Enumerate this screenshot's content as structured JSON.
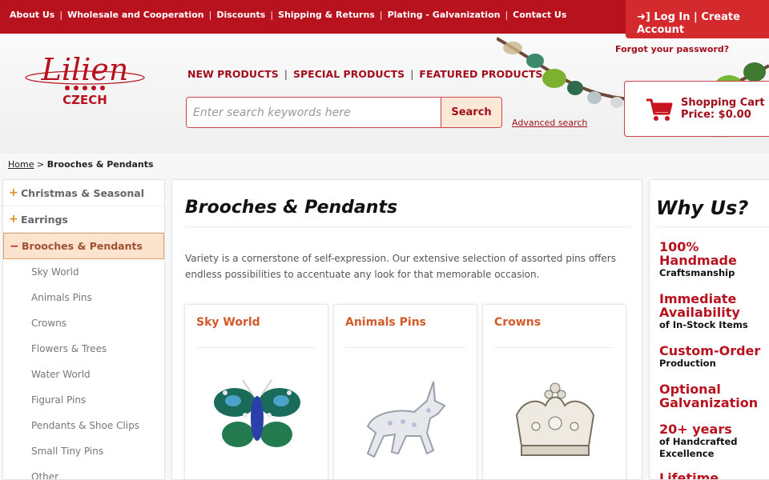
{
  "topnav": {
    "items": [
      "About Us",
      "Wholesale and Cooperation",
      "Discounts",
      "Shipping & Returns",
      "Plating - Galvanization",
      "Contact Us"
    ]
  },
  "account": {
    "login": "Log In",
    "create": "Create Account",
    "forgot": "Forgot your password?"
  },
  "brand": {
    "name": "Lilien",
    "sub": "CZECH",
    "color": "#b8121f"
  },
  "mainnav": [
    "NEW PRODUCTS",
    "SPECIAL PRODUCTS",
    "FEATURED PRODUCTS"
  ],
  "search": {
    "placeholder": "Enter search keywords here",
    "button": "Search",
    "advanced": "Advanced search"
  },
  "cart": {
    "label": "Shopping Cart",
    "price": "Price: $0.00"
  },
  "breadcrumb": {
    "home": "Home",
    "current": "Brooches & Pendants"
  },
  "sidebar": {
    "categories": [
      {
        "label": "Christmas & Seasonal",
        "icon": "+"
      },
      {
        "label": "Earrings",
        "icon": "+"
      },
      {
        "label": "Brooches & Pendants",
        "icon": "−"
      }
    ],
    "subcategories": [
      "Sky World",
      "Animals Pins",
      "Crowns",
      "Flowers & Trees",
      "Water World",
      "Figural Pins",
      "Pendants & Shoe Clips",
      "Small Tiny Pins",
      "Other"
    ]
  },
  "main": {
    "title": "Brooches & Pendants",
    "intro": "Variety is a cornerstone of self-expression. Our extensive selection of assorted pins offers endless possibilities to accentuate any look for that memorable occasion.",
    "cards": [
      {
        "title": "Sky World",
        "image": "butterfly-brooch"
      },
      {
        "title": "Animals Pins",
        "image": "unicorn-brooch"
      },
      {
        "title": "Crowns",
        "image": "crown-brooch"
      }
    ]
  },
  "why": {
    "title": "Why Us?",
    "items": [
      {
        "big": "100% Handmade",
        "small": "Craftsmanship"
      },
      {
        "big": "Immediate Availability",
        "small": "of In-Stock Items"
      },
      {
        "big": "Custom-Order",
        "small": "Production"
      },
      {
        "big": "Optional Galvanization",
        "small": ""
      },
      {
        "big": "20+ years",
        "small": "of Handcrafted Excellence"
      },
      {
        "big": "Lifetime",
        "small": ""
      }
    ]
  }
}
